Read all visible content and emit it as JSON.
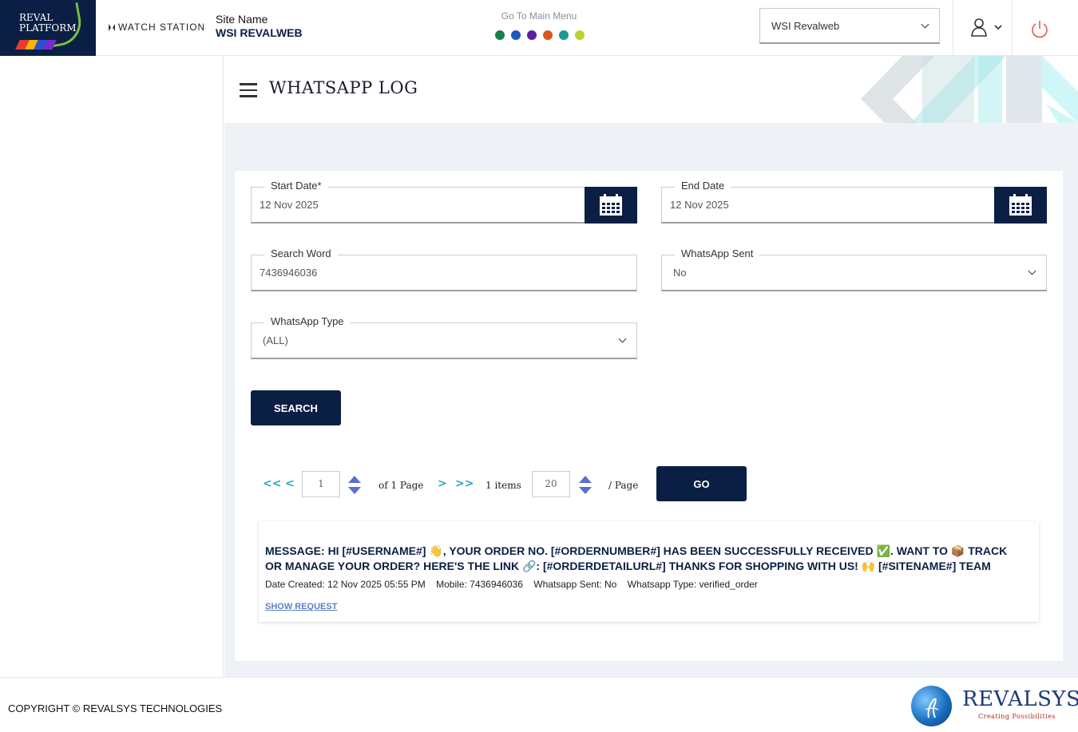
{
  "header": {
    "logo_line1": "REVAL",
    "logo_line2": "PLATFORM",
    "brand": "WATCH STATION",
    "site_name_label": "Site Name",
    "site_name_value": "WSI REVALWEB",
    "goto_main_menu": "Go To Main Menu",
    "menu_dot_colors": [
      "#1a7d4e",
      "#1d59b8",
      "#5b1fa0",
      "#d65a1a",
      "#1a9a96",
      "#b7d334"
    ],
    "site_select_value": "WSI Revalweb",
    "user_icon": "user-icon",
    "power_icon": "power-icon"
  },
  "page": {
    "title": "WHATSAPP LOG",
    "menu_icon": "hamburger-icon"
  },
  "filters": {
    "start_date_label": "Start Date*",
    "start_date_value": "12 Nov 2025",
    "end_date_label": "End Date",
    "end_date_value": "12 Nov 2025",
    "search_word_label": "Search Word",
    "search_word_value": "7436946036",
    "whatsapp_sent_label": "WhatsApp Sent",
    "whatsapp_sent_value": "No",
    "whatsapp_type_label": "WhatsApp Type",
    "whatsapp_type_value": "(ALL)",
    "search_button": "SEARCH"
  },
  "pagination": {
    "first": "<<",
    "prev": "<",
    "next": ">",
    "last": ">>",
    "page_value": "1",
    "of_pages": "of 1 Page",
    "items_count": "1 items",
    "per_page_value": "20",
    "per_page_label": "/ Page",
    "go_button": "GO"
  },
  "log_items": [
    {
      "message": "MESSAGE: HI [#USERNAME#] 👋, YOUR ORDER NO. [#ORDERNUMBER#] HAS BEEN SUCCESSFULLY RECEIVED ✅. WANT TO 📦 TRACK OR MANAGE YOUR ORDER? HERE'S THE LINK 🔗: [#ORDERDETAILURL#] THANKS FOR SHOPPING WITH US! 🙌 [#SITENAME#] TEAM",
      "date_created": "Date Created: 12 Nov 2025 05:55 PM",
      "mobile": "Mobile: 7436946036",
      "whatsapp_sent": "Whatsapp Sent: No",
      "whatsapp_type": "Whatsapp Type: verified_order",
      "show_request": "SHOW REQUEST"
    }
  ],
  "footer": {
    "copyright": "COPYRIGHT © REVALSYS TECHNOLOGIES",
    "company_name": "REVALSYS",
    "company_tagline": "Creating Possibilities"
  }
}
